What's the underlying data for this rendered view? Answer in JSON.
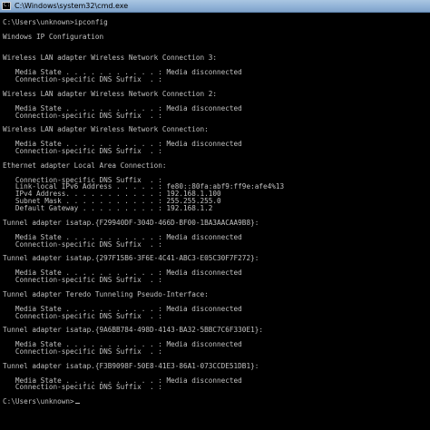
{
  "window": {
    "title": "C:\\Windows\\system32\\cmd.exe",
    "icon": "cmd-icon",
    "background_color": "#000000",
    "text_color": "#c0c0c0"
  },
  "console": {
    "lines": [
      "C:\\Users\\unknown>ipconfig",
      "",
      "Windows IP Configuration",
      "",
      "",
      "Wireless LAN adapter Wireless Network Connection 3:",
      "",
      "   Media State . . . . . . . . . . . : Media disconnected",
      "   Connection-specific DNS Suffix  . :",
      "",
      "Wireless LAN adapter Wireless Network Connection 2:",
      "",
      "   Media State . . . . . . . . . . . : Media disconnected",
      "   Connection-specific DNS Suffix  . :",
      "",
      "Wireless LAN adapter Wireless Network Connection:",
      "",
      "   Media State . . . . . . . . . . . : Media disconnected",
      "   Connection-specific DNS Suffix  . :",
      "",
      "Ethernet adapter Local Area Connection:",
      "",
      "   Connection-specific DNS Suffix  . :",
      "   Link-local IPv6 Address . . . . . : fe80::80fa:abf9:ff9e:afe4%13",
      "   IPv4 Address. . . . . . . . . . . : 192.168.1.100",
      "   Subnet Mask . . . . . . . . . . . : 255.255.255.0",
      "   Default Gateway . . . . . . . . . : 192.168.1.2",
      "",
      "Tunnel adapter isatap.{F29940DF-304D-466D-BF00-1BA3AACAA9B8}:",
      "",
      "   Media State . . . . . . . . . . . : Media disconnected",
      "   Connection-specific DNS Suffix  . :",
      "",
      "Tunnel adapter isatap.{297F15B6-3F6E-4C41-ABC3-E05C30F7F272}:",
      "",
      "   Media State . . . . . . . . . . . : Media disconnected",
      "   Connection-specific DNS Suffix  . :",
      "",
      "Tunnel adapter Teredo Tunneling Pseudo-Interface:",
      "",
      "   Media State . . . . . . . . . . . : Media disconnected",
      "   Connection-specific DNS Suffix  . :",
      "",
      "Tunnel adapter isatap.{9A6BB784-498D-4143-BA32-5BBC7C6F330E1}:",
      "",
      "   Media State . . . . . . . . . . . : Media disconnected",
      "   Connection-specific DNS Suffix  . :",
      "",
      "Tunnel adapter isatap.{F3B9098F-50E8-41E3-86A1-073CCDE51DB1}:",
      "",
      "   Media State . . . . . . . . . . . : Media disconnected",
      "   Connection-specific DNS Suffix  . :",
      "",
      "C:\\Users\\unknown>"
    ]
  }
}
